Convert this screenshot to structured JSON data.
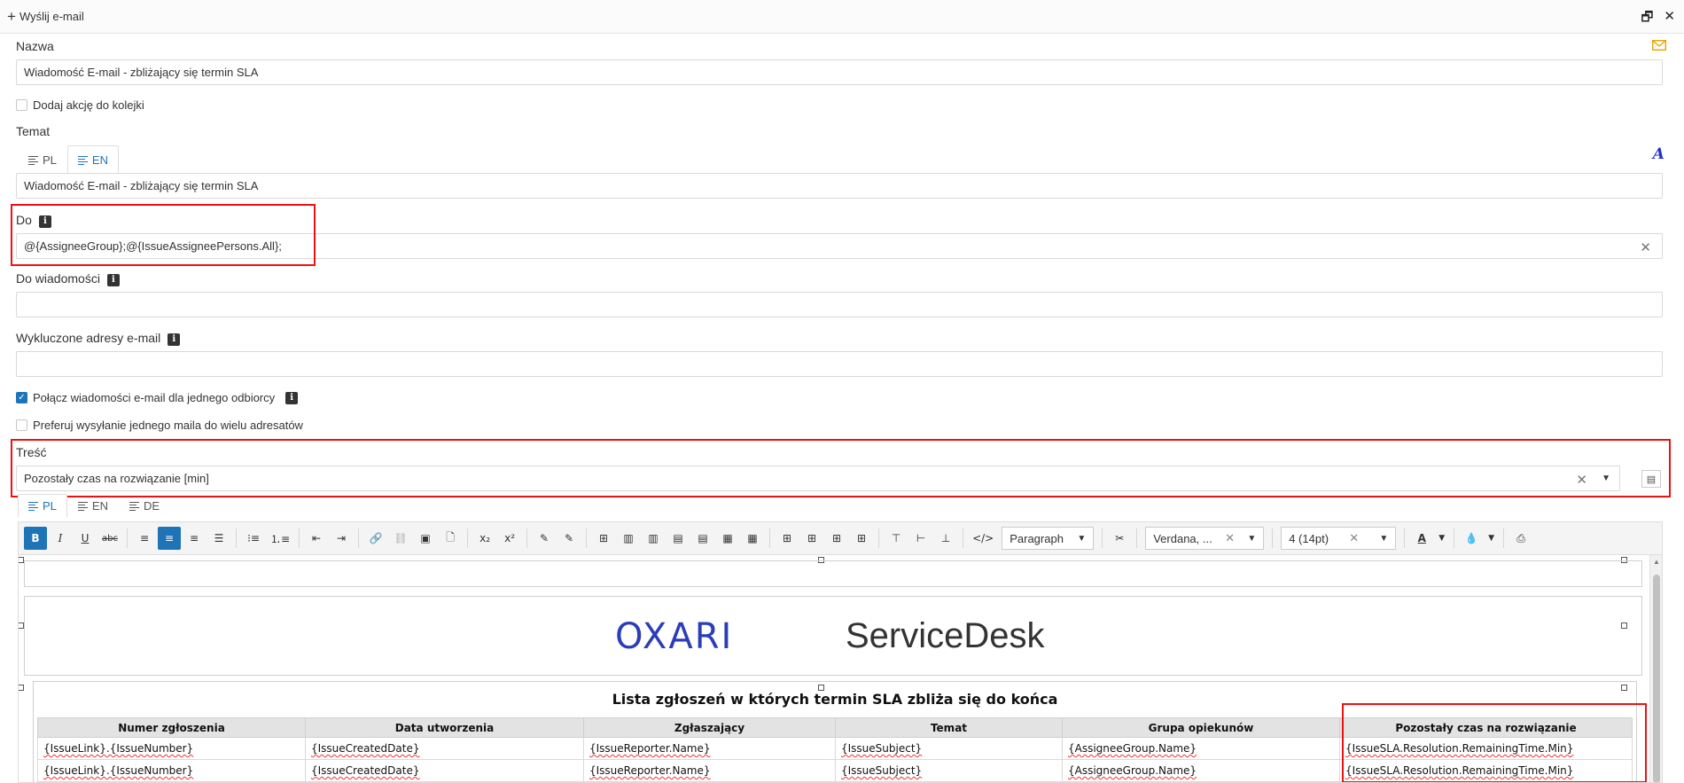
{
  "window": {
    "title": "Wyślij e-mail"
  },
  "form": {
    "nazwa_label": "Nazwa",
    "nazwa_value": "Wiadomość E-mail - zbliżający się termin SLA",
    "queue_label": "Dodaj akcję do kolejki",
    "temat_label": "Temat",
    "temat_tabs": [
      "PL",
      "EN"
    ],
    "temat_value": "Wiadomość E-mail - zbliżający się termin SLA",
    "do_label": "Do",
    "do_value": "@{AssigneeGroup};@{IssueAssigneePersons.All};",
    "dowiad_label": "Do wiadomości",
    "dowiad_value": "",
    "excluded_label": "Wykluczone adresy e-mail",
    "excluded_value": "",
    "merge_label": "Połącz wiadomości e-mail dla jednego odbiorcy",
    "prefer_label": "Preferuj wysyłanie jednego maila do wielu adresatów",
    "tresc_label": "Treść",
    "tresc_value": "Pozostały czas na rozwiązanie [min]",
    "body_tabs": [
      "PL",
      "EN",
      "DE"
    ]
  },
  "toolbar": {
    "bold": "B",
    "italic": "I",
    "underline": "U",
    "strike": "abc",
    "sub": "x₂",
    "sup": "x²",
    "code": "</>",
    "paragraph": "Paragraph",
    "font": "Verdana, ...",
    "size": "4 (14pt)",
    "font_color": "A"
  },
  "editor": {
    "logo_left": "OXARI",
    "logo_right": "ServiceDesk",
    "heading": "Lista zgłoszeń w których termin SLA zbliża się do końca",
    "columns": [
      "Numer zgłoszenia",
      "Data utworzenia",
      "Zgłaszający",
      "Temat",
      "Grupa opiekunów",
      "Pozostały czas na rozwiązanie"
    ],
    "rows": [
      [
        "{IssueLink}.{IssueNumber}",
        "{IssueCreatedDate}",
        "{IssueReporter.Name}",
        "{IssueSubject}",
        "{AssigneeGroup.Name}",
        "{IssueSLA.Resolution.RemainingTime.Min}"
      ],
      [
        "{IssueLink}.{IssueNumber}",
        "{IssueCreatedDate}",
        "{IssueReporter.Name}",
        "{IssueSubject}",
        "{AssigneeGroup.Name}",
        "{IssueSLA.Resolution.RemainingTime.Min}"
      ]
    ]
  },
  "colors": {
    "accent": "#1f74b8",
    "highlight": "#e11111",
    "logo": "#2b3db8",
    "mail_icon": "#e8a400"
  }
}
